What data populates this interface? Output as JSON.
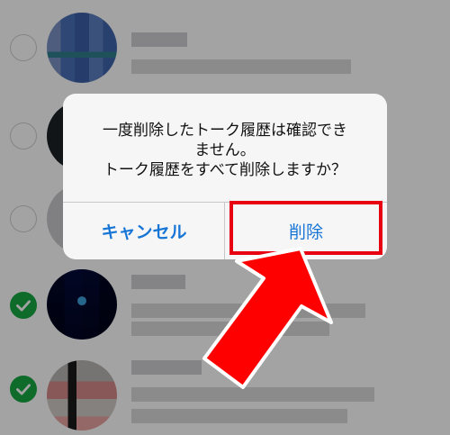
{
  "alert": {
    "message_lines": [
      "一度削除したトーク履歴は確認でき",
      "ません。",
      "トーク履歴をすべて削除しますか？"
    ],
    "cancel_label": "キャンセル",
    "delete_label": "削除"
  },
  "chat_rows": [
    {
      "selected": false,
      "avatar": "blurred-blue-avatar"
    },
    {
      "selected": false,
      "avatar": "blurred-dark-avatar"
    },
    {
      "selected": false,
      "avatar": "blurred-gray-avatar"
    },
    {
      "selected": true,
      "avatar": "blurred-navy-avatar"
    },
    {
      "selected": true,
      "avatar": "blurred-photo-avatar"
    }
  ],
  "colors": {
    "accent_blue": "#1775d6",
    "check_green": "#18a843",
    "annotation_red": "#e60012"
  }
}
